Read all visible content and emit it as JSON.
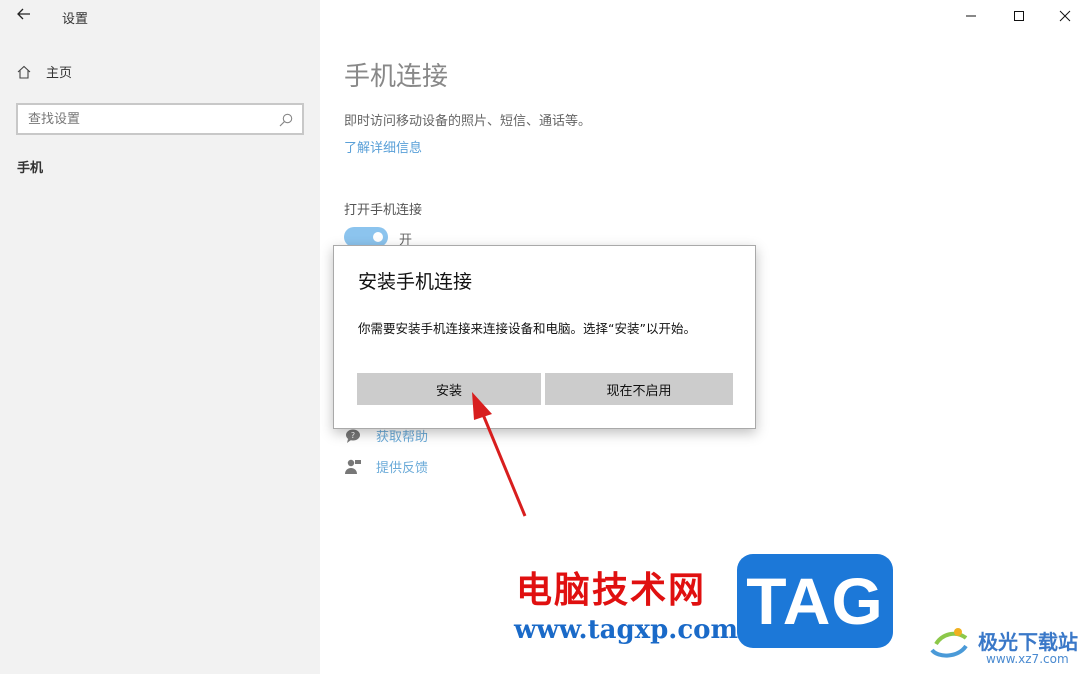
{
  "window": {
    "title": "设置",
    "minimize_icon": "minimize-icon",
    "maximize_icon": "maximize-icon",
    "close_icon": "close-icon"
  },
  "sidebar": {
    "home_label": "主页",
    "search_placeholder": "查找设置",
    "section_label": "手机"
  },
  "main": {
    "title": "手机连接",
    "description": "即时访问移动设备的照片、短信、通话等。",
    "learn_more": "了解详细信息",
    "toggle_label": "打开手机连接",
    "toggle_state": "开",
    "toggle_on": true,
    "get_help": "获取帮助",
    "feedback": "提供反馈"
  },
  "dialog": {
    "title": "安装手机连接",
    "message": "你需要安装手机连接来连接设备和电脑。选择“安装”以开始。",
    "install_button": "安装",
    "not_now_button": "现在不启用"
  },
  "watermark": {
    "site_name_cn": "电脑技术网",
    "site_url": "www.tagxp.com",
    "badge": "TAG",
    "logo_text": "极光下载站",
    "logo_url": "www.xz7.com"
  },
  "colors": {
    "accent": "#8cc4ee",
    "link": "#5aa0d8",
    "arrow": "#d81e1e",
    "watermark_red": "#e01010",
    "watermark_blue": "#1a6ac8",
    "badge_blue": "#1c78d8"
  }
}
